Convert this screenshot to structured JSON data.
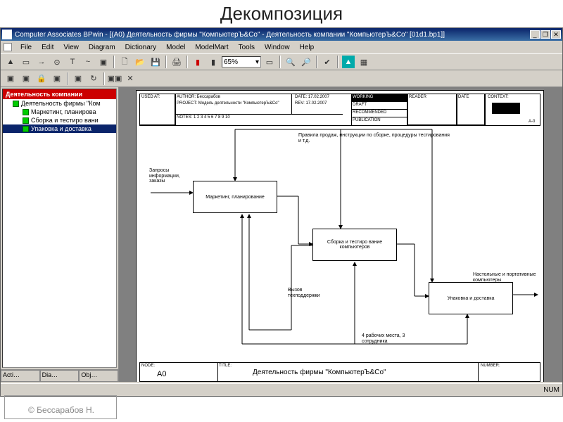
{
  "page_heading": "Декомпозиция",
  "titlebar": {
    "text": "Computer Associates BPwin - [(A0) Деятельность фирмы \"КомпьютерЪ&Co\" - Деятельность компании \"КомпьютерЪ&Co\"  [01d1.bp1]]"
  },
  "window_controls": {
    "min": "_",
    "max": "❐",
    "close": "✕"
  },
  "menu": {
    "file": "File",
    "edit": "Edit",
    "view": "View",
    "diagram": "Diagram",
    "dictionary": "Dictionary",
    "model": "Model",
    "modelmart": "ModelMart",
    "tools": "Tools",
    "window": "Window",
    "help": "Help"
  },
  "toolbar": {
    "zoom": "65%"
  },
  "tree": {
    "header": "Деятельность компании",
    "items": [
      "Деятельность фирмы \"Ком",
      "Маркетинг, планирова",
      "Сборка и тестиро вани",
      "Упаковка и доставка"
    ]
  },
  "sidebar_tabs": {
    "t1": "Acti…",
    "t2": "Dia…",
    "t3": "Obj…"
  },
  "header_block": {
    "used_at": "USED AT:",
    "author_lbl": "AUTHOR:",
    "author_val": "Бессарабов",
    "project_lbl": "PROJECT:",
    "project_val": "Модель деятельности \"КомпьютерЪ&Co\"",
    "notes": "NOTES:  1  2  3  4  5  6  7  8  9  10",
    "date_lbl": "DATE:",
    "date_val": "17.02.2007",
    "rev_lbl": "REV:",
    "rev_val": "17.02.2007",
    "working": "WORKING",
    "draft": "DRAFT",
    "recommended": "RECOMMENDED",
    "publication": "PUBLICATION",
    "reader": "READER",
    "date2": "DATE",
    "context": "CONTEXT:",
    "context_node": "A-0"
  },
  "labels": {
    "top_rules": "Правила продаж, инструкции по сборке, процедуры тестирования и т.д.",
    "requests": "Запросы информации, заказы",
    "tech": "Вызов техподдержки",
    "workers": "4 рабочих места, 3 сотрудника",
    "output": "Настольные и портативные компьютеры"
  },
  "boxes": {
    "b1": "Маркетинг, планирование",
    "b2": "Сборка и тестиро вание компьютеров",
    "b3": "Упаковка и доставка"
  },
  "footer": {
    "node_lbl": "NODE:",
    "node_val": "A0",
    "title_lbl": "TITLE:",
    "title_val": "Деятельность фирмы \"КомпьютерЪ&Co\"",
    "number_lbl": "NUMBER:"
  },
  "statusbar": {
    "num": "NUM"
  },
  "credit": "© Бессарабов Н."
}
